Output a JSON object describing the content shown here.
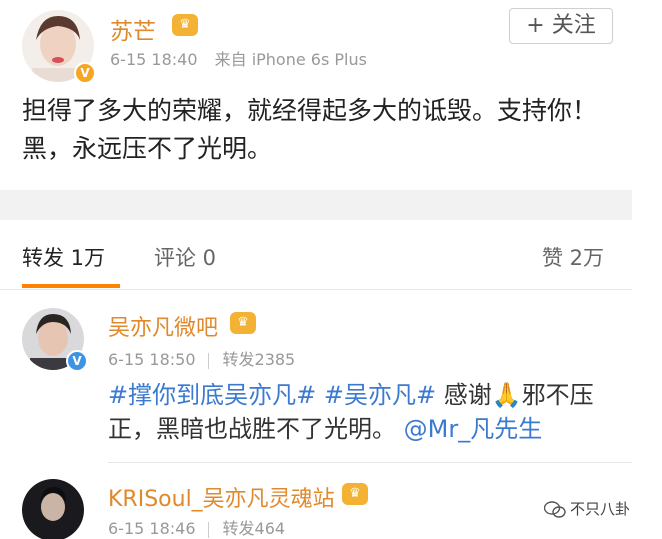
{
  "post": {
    "username": "苏芒",
    "timestamp": "6-15 18:40",
    "source": "来自 iPhone 6s Plus",
    "follow_label": "+ 关注",
    "text": "担得了多大的荣耀，就经得起多大的诋毁。支持你！黑，永远压不了光明。"
  },
  "tabs": {
    "repost": "转发 1万",
    "comment": "评论 0",
    "like": "赞 2万"
  },
  "reposts": [
    {
      "username": "吴亦凡微吧",
      "timestamp": "6-15 18:50",
      "count": "转发2385",
      "tag1": "#撑你到底吴亦凡#",
      "tag2": "#吴亦凡#",
      "text_mid": " 感谢🙏邪不压正，黑暗也战胜不了光明。",
      "mention": "@Mr_凡先生"
    },
    {
      "username": "KRISoul_吴亦凡灵魂站",
      "timestamp": "6-15 18:46",
      "count": "转发464"
    }
  ],
  "watermark": "不只八卦",
  "colors": {
    "username": "#e0892c",
    "topic_link": "#3b7ad1",
    "tab_active_underline": "#ff8200",
    "verified_blue": "#3d94e6",
    "verified_orange": "#f5a623"
  }
}
